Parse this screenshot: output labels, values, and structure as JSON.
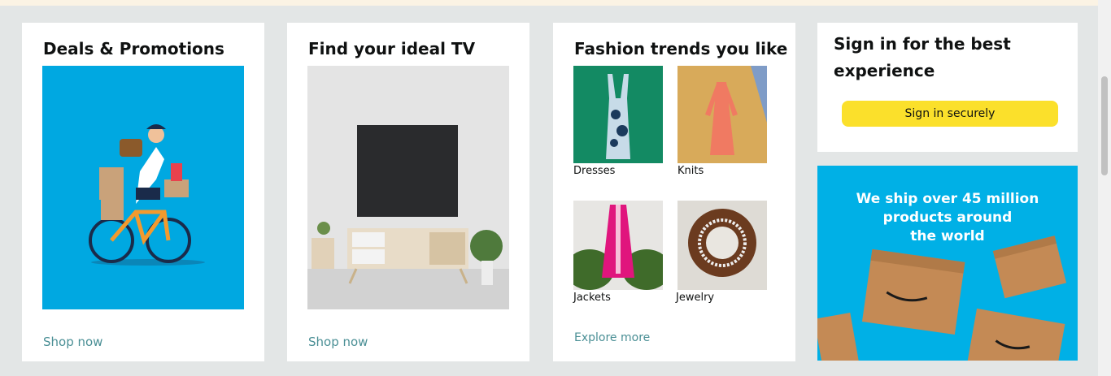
{
  "cards": {
    "deals": {
      "title": "Deals & Promotions",
      "cta": "Shop now"
    },
    "tv": {
      "title": "Find your ideal TV",
      "cta": "Shop now"
    },
    "fashion": {
      "title": "Fashion trends you like",
      "items": [
        {
          "label": "Dresses"
        },
        {
          "label": "Knits"
        },
        {
          "label": "Jackets"
        },
        {
          "label": "Jewelry"
        }
      ],
      "cta": "Explore more"
    },
    "signin": {
      "title": "Sign in for the best experience",
      "button": "Sign in securely"
    },
    "shipping_ad": {
      "line1": "We ship over 45 million",
      "line2": "products around",
      "line3": "the world"
    }
  },
  "colors": {
    "accent_yellow": "#fbe02b",
    "link_teal": "#4a8f95",
    "ad_blue": "#00a8e1"
  }
}
